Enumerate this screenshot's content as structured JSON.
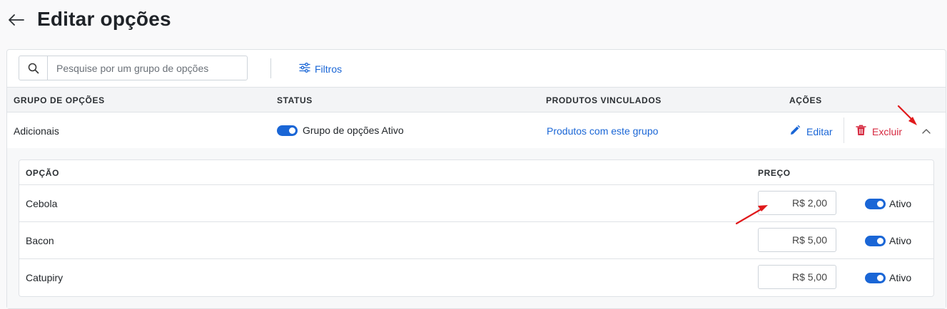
{
  "header": {
    "title": "Editar opções",
    "back_icon": "arrow-left-icon"
  },
  "toolbar": {
    "search_placeholder": "Pesquise por um grupo de opções",
    "search_value": "",
    "filters_label": "Filtros"
  },
  "table": {
    "columns": [
      "GRUPO DE OPÇÕES",
      "STATUS",
      "PRODUTOS VINCULADOS",
      "AÇÕES"
    ],
    "rows": [
      {
        "group": "Adicionais",
        "status": "Grupo de opções Ativo",
        "status_on": true,
        "linked_products": "Produtos com este grupo",
        "edit_label": "Editar",
        "delete_label": "Excluir",
        "expanded": true
      }
    ]
  },
  "options": {
    "columns": [
      "OPÇÃO",
      "PREÇO"
    ],
    "rows": [
      {
        "name": "Cebola",
        "price": "R$ 2,00",
        "status": "Ativo",
        "on": true
      },
      {
        "name": "Bacon",
        "price": "R$ 5,00",
        "status": "Ativo",
        "on": true
      },
      {
        "name": "Catupiry",
        "price": "R$ 5,00",
        "status": "Ativo",
        "on": true
      }
    ]
  },
  "colors": {
    "accent": "#1a66d6",
    "danger": "#d6283f",
    "annotation": "#e0191b"
  }
}
